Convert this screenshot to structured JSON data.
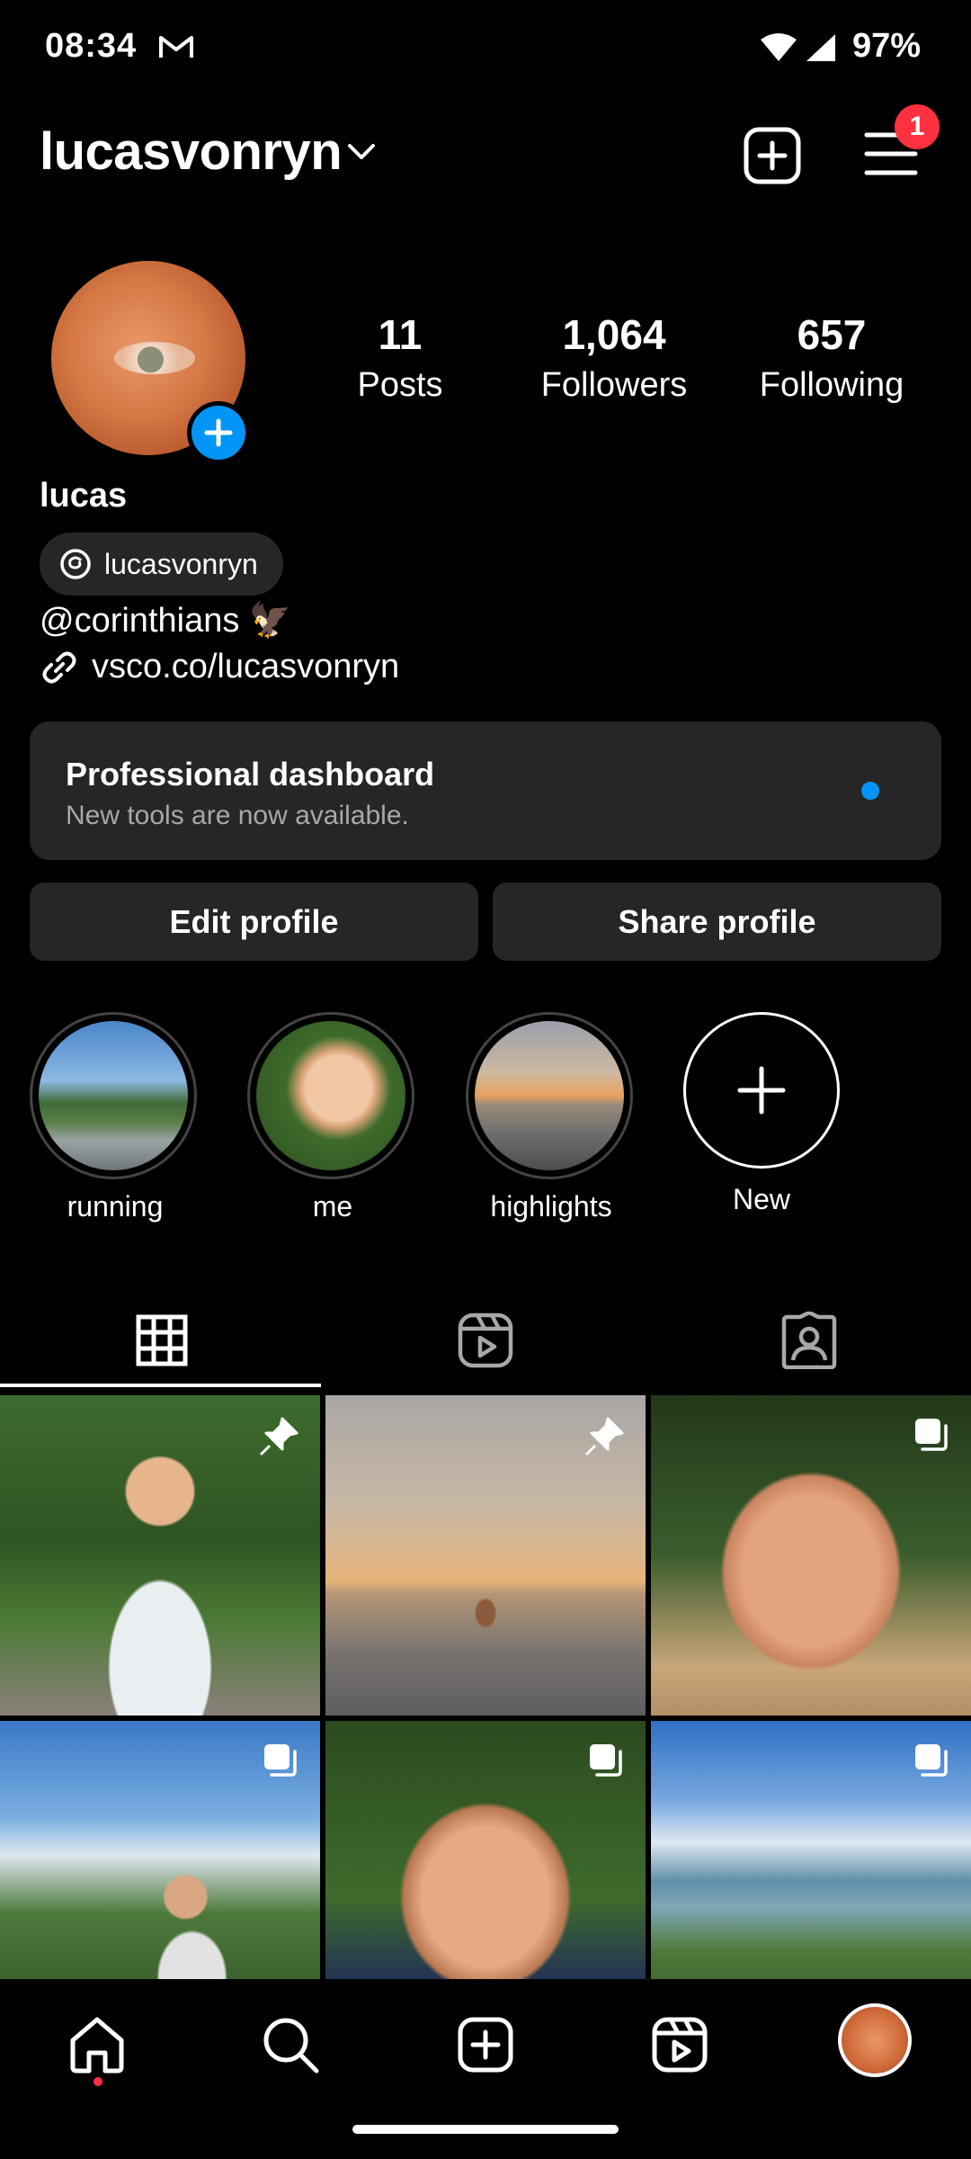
{
  "status_bar": {
    "time": "08:34",
    "battery": "97%"
  },
  "header": {
    "username": "lucasvonryn",
    "notification_count": "1"
  },
  "profile": {
    "stats": [
      {
        "value": "11",
        "label": "Posts"
      },
      {
        "value": "1,064",
        "label": "Followers"
      },
      {
        "value": "657",
        "label": "Following"
      }
    ],
    "display_name": "lucas",
    "threads_handle": "lucasvonryn",
    "bio": "@corinthians 🦅",
    "link": "vsco.co/lucasvonryn"
  },
  "dashboard": {
    "title": "Professional dashboard",
    "subtitle": "New tools are now available."
  },
  "buttons": {
    "edit": "Edit profile",
    "share": "Share profile"
  },
  "highlights": [
    {
      "label": "running"
    },
    {
      "label": "me"
    },
    {
      "label": "highlights"
    },
    {
      "label": "New"
    }
  ],
  "colors": {
    "accent": "#0095f6",
    "badge": "#ff3040",
    "surface": "#262626",
    "background": "#000000"
  }
}
